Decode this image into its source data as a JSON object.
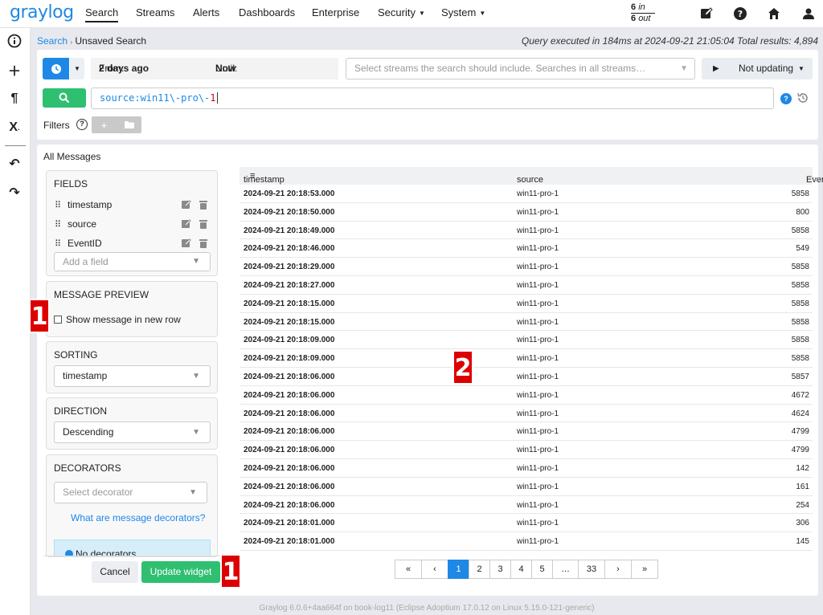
{
  "nav": {
    "logo": "graylog",
    "items": [
      "Search",
      "Streams",
      "Alerts",
      "Dashboards",
      "Enterprise",
      "Security",
      "System"
    ],
    "throughput_in_value": "6",
    "throughput_in_label": "in",
    "throughput_out_value": "6",
    "throughput_out_label": "out"
  },
  "breadcrumb": {
    "search": "Search",
    "current": "Unsaved Search"
  },
  "query_info": "Query executed in 184ms at 2024-09-21 21:05:04 Total results: 4,894",
  "timerange": {
    "from_label": "From:",
    "from_value": "2 days ago",
    "until_label": "Until:",
    "until_value": "Now"
  },
  "streams_placeholder": "Select streams the search should include. Searches in all streams…",
  "refresh_label": "Not updating",
  "query": {
    "prefix": "source:win11\\-pro\\-",
    "suffix": "1"
  },
  "filters_label": "Filters",
  "widget_title": "All Messages",
  "fields_card": {
    "title": "FIELDS",
    "fields": [
      "timestamp",
      "source",
      "EventID"
    ],
    "add_placeholder": "Add a field"
  },
  "preview_card": {
    "title": "MESSAGE PREVIEW",
    "checkbox_label": "Show message in new row"
  },
  "sorting_card": {
    "title": "SORTING",
    "value": "timestamp"
  },
  "direction_card": {
    "title": "DIRECTION",
    "value": "Descending"
  },
  "decorators_card": {
    "title": "DECORATORS",
    "placeholder": "Select decorator",
    "link": "What are message decorators?",
    "alert": "No decorators"
  },
  "buttons": {
    "cancel": "Cancel",
    "update": "Update widget"
  },
  "table": {
    "headers": [
      "timestamp",
      "source",
      "EventID"
    ],
    "rows": [
      [
        "2024-09-21 20:18:53.000",
        "win11-pro-1",
        "5858"
      ],
      [
        "2024-09-21 20:18:50.000",
        "win11-pro-1",
        "800"
      ],
      [
        "2024-09-21 20:18:49.000",
        "win11-pro-1",
        "5858"
      ],
      [
        "2024-09-21 20:18:46.000",
        "win11-pro-1",
        "549"
      ],
      [
        "2024-09-21 20:18:29.000",
        "win11-pro-1",
        "5858"
      ],
      [
        "2024-09-21 20:18:27.000",
        "win11-pro-1",
        "5858"
      ],
      [
        "2024-09-21 20:18:15.000",
        "win11-pro-1",
        "5858"
      ],
      [
        "2024-09-21 20:18:15.000",
        "win11-pro-1",
        "5858"
      ],
      [
        "2024-09-21 20:18:09.000",
        "win11-pro-1",
        "5858"
      ],
      [
        "2024-09-21 20:18:09.000",
        "win11-pro-1",
        "5858"
      ],
      [
        "2024-09-21 20:18:06.000",
        "win11-pro-1",
        "5857"
      ],
      [
        "2024-09-21 20:18:06.000",
        "win11-pro-1",
        "4672"
      ],
      [
        "2024-09-21 20:18:06.000",
        "win11-pro-1",
        "4624"
      ],
      [
        "2024-09-21 20:18:06.000",
        "win11-pro-1",
        "4799"
      ],
      [
        "2024-09-21 20:18:06.000",
        "win11-pro-1",
        "4799"
      ],
      [
        "2024-09-21 20:18:06.000",
        "win11-pro-1",
        "142"
      ],
      [
        "2024-09-21 20:18:06.000",
        "win11-pro-1",
        "161"
      ],
      [
        "2024-09-21 20:18:06.000",
        "win11-pro-1",
        "254"
      ],
      [
        "2024-09-21 20:18:01.000",
        "win11-pro-1",
        "306"
      ],
      [
        "2024-09-21 20:18:01.000",
        "win11-pro-1",
        "145"
      ]
    ]
  },
  "pagination": {
    "first": "«",
    "prev": "‹",
    "pages": [
      "1",
      "2",
      "3",
      "4",
      "5"
    ],
    "ellipsis": "…",
    "last_page": "33",
    "next": "›",
    "last": "»",
    "active": "1"
  },
  "markers": {
    "m1a": "1",
    "m2": "2",
    "m1b": "1"
  },
  "footer": "Graylog 6.0.6+4aa664f on book-log11 (Eclipse Adoptium 17.0.12 on Linux 5.15.0-121-generic)",
  "icons": {
    "sidebar": [
      "info-icon",
      "plus-icon",
      "pilcrow-icon",
      "x-clear-icon",
      "undo-icon",
      "redo-icon"
    ],
    "topbar": [
      "edit-icon",
      "help-icon",
      "home-icon",
      "user-icon"
    ]
  },
  "colors": {
    "accent": "#1e88e5",
    "success": "#2fbf71",
    "marker": "#dd0000"
  }
}
